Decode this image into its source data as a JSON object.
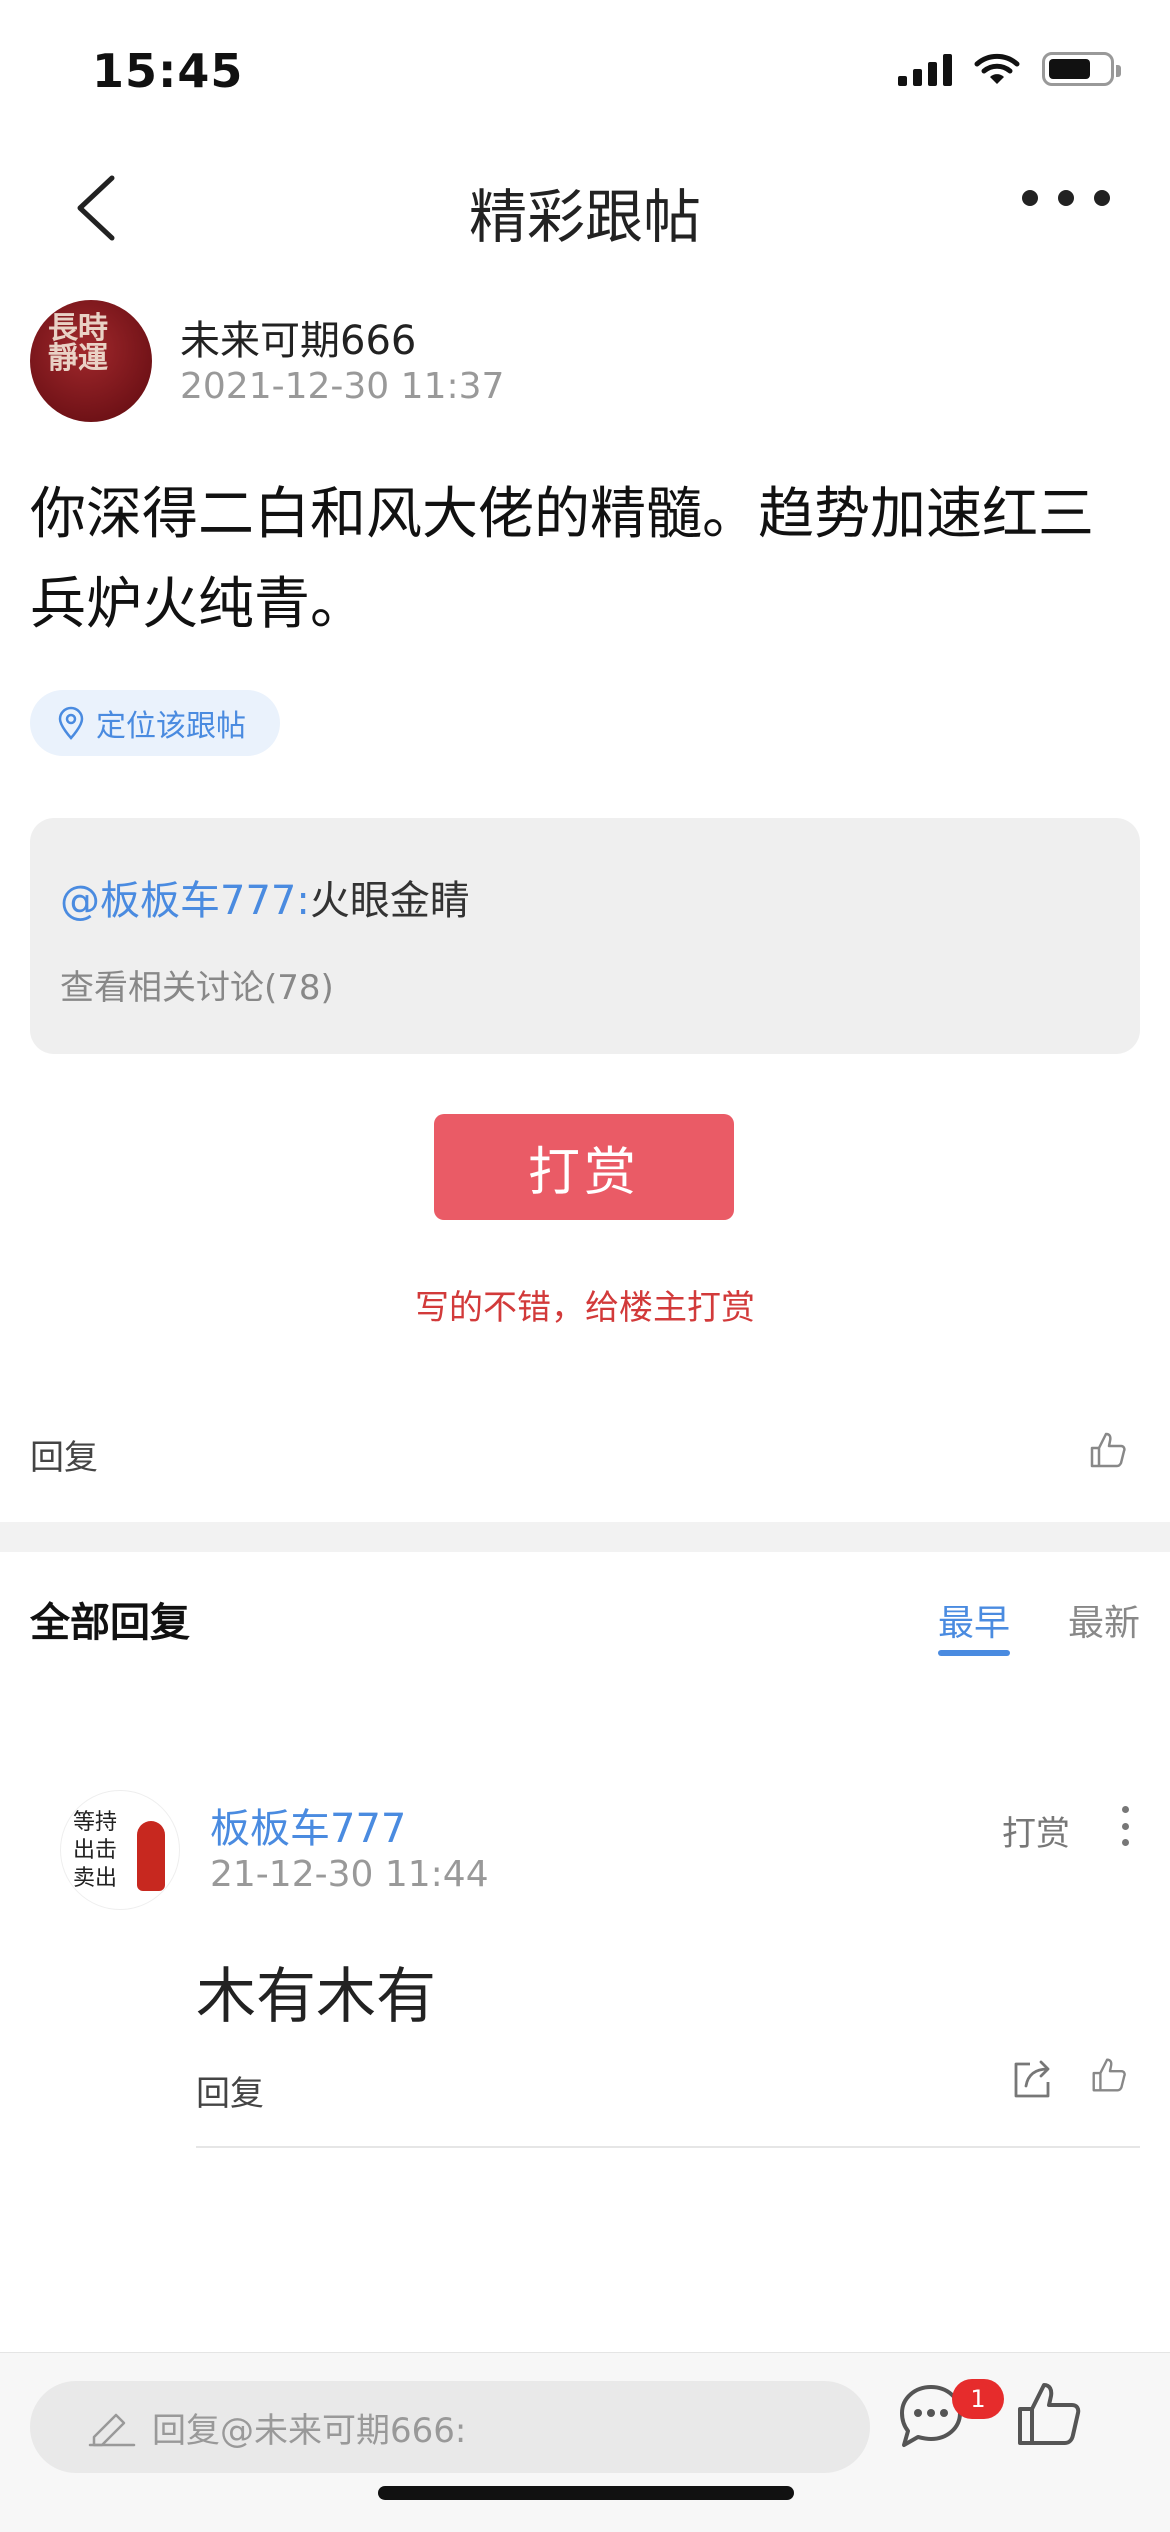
{
  "status_bar": {
    "time": "15:45"
  },
  "nav": {
    "title": "精彩跟帖"
  },
  "post": {
    "author": "未来可期666",
    "time": "2021-12-30 11:37",
    "body": "你深得二白和风大佬的精髓。趋势加速红三兵炉火纯青。",
    "locate_label": "定位该跟帖"
  },
  "quote": {
    "user": "@板板车777:",
    "text": "火眼金睛",
    "related": "查看相关讨论(78)"
  },
  "tip": {
    "button": "打赏",
    "note": "写的不错，给楼主打赏"
  },
  "post_actions": {
    "reply": "回复"
  },
  "replies": {
    "title": "全部回复",
    "sort_earliest": "最早",
    "sort_newest": "最新",
    "items": [
      {
        "author": "板板车777",
        "time": "21-12-30 11:44",
        "text": "木有木有",
        "tip": "打赏",
        "reply": "回复"
      }
    ]
  },
  "bottom_bar": {
    "placeholder": "回复@未来可期666:",
    "message_badge": "1"
  },
  "colors": {
    "accent": "#4a8be0",
    "tip_red": "#ea5b66",
    "note_red": "#d23a3a"
  }
}
